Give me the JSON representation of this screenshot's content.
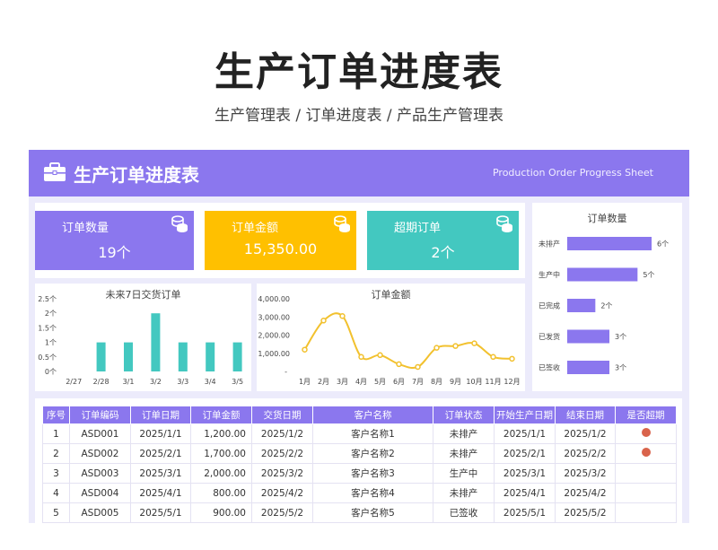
{
  "page": {
    "title": "生产订单进度表",
    "subtitle": "生产管理表 / 订单进度表 / 产品生产管理表"
  },
  "banner": {
    "title": "生产订单进度表",
    "subtitle_en": "Production Order Progress Sheet",
    "icon": "briefcase-icon",
    "color": "#8b77ee"
  },
  "cards": [
    {
      "label": "订单数量",
      "value": "19个",
      "color": "#8b77ee",
      "icon": "coins-icon"
    },
    {
      "label": "订单金额",
      "value": "15,350.00",
      "color": "#ffc000",
      "icon": "coins-icon"
    },
    {
      "label": "超期订单",
      "value": "2个",
      "color": "#43c8c0",
      "icon": "coins-icon"
    }
  ],
  "chart_data": [
    {
      "type": "bar",
      "title": "订单数量",
      "orientation": "horizontal",
      "categories": [
        "未排产",
        "生产中",
        "已完成",
        "已发货",
        "已签收"
      ],
      "values": [
        6,
        5,
        2,
        3,
        3
      ],
      "value_labels": [
        "6个",
        "5个",
        "2个",
        "3个",
        "3个"
      ],
      "xlim": [
        0,
        6
      ],
      "color": "#8b77ee"
    },
    {
      "type": "bar",
      "title": "未来7日交货订单",
      "categories": [
        "2/27",
        "2/28",
        "3/1",
        "3/2",
        "3/3",
        "3/4",
        "3/5"
      ],
      "values": [
        0,
        1,
        1,
        2,
        1,
        1,
        1
      ],
      "yticks": [
        "0个",
        "0.5个",
        "1个",
        "1.5个",
        "2个",
        "2.5个"
      ],
      "ylim": [
        0,
        2.5
      ],
      "color": "#43c8c0"
    },
    {
      "type": "line",
      "title": "订单金额",
      "categories": [
        "1月",
        "2月",
        "3月",
        "4月",
        "5月",
        "6月",
        "7月",
        "8月",
        "9月",
        "10月",
        "11月",
        "12月"
      ],
      "values": [
        1200,
        2800,
        3050,
        800,
        900,
        400,
        250,
        1300,
        1400,
        1550,
        800,
        700
      ],
      "yticks": [
        "-",
        "1,000.00",
        "2,000.00",
        "3,000.00",
        "4,000.00"
      ],
      "ylim": [
        0,
        4000
      ],
      "color": "#f2c12e"
    }
  ],
  "table": {
    "headers": [
      "序号",
      "订单编码",
      "订单日期",
      "订单金额",
      "交货日期",
      "客户名称",
      "订单状态",
      "开始生产日期",
      "结束日期",
      "是否超期"
    ],
    "rows": [
      [
        "1",
        "ASD001",
        "2025/1/1",
        "1,200.00",
        "2025/1/2",
        "客户名称1",
        "未排产",
        "2025/1/1",
        "2025/1/2",
        "overdue"
      ],
      [
        "2",
        "ASD002",
        "2025/2/1",
        "1,700.00",
        "2025/2/2",
        "客户名称2",
        "未排产",
        "2025/2/1",
        "2025/2/2",
        "overdue"
      ],
      [
        "3",
        "ASD003",
        "2025/3/1",
        "2,000.00",
        "2025/3/2",
        "客户名称3",
        "生产中",
        "2025/3/1",
        "2025/3/2",
        ""
      ],
      [
        "4",
        "ASD004",
        "2025/4/1",
        "800.00",
        "2025/4/2",
        "客户名称4",
        "未排产",
        "2025/4/1",
        "2025/4/2",
        ""
      ],
      [
        "5",
        "ASD005",
        "2025/5/1",
        "900.00",
        "2025/5/2",
        "客户名称5",
        "已签收",
        "2025/5/1",
        "2025/5/2",
        ""
      ]
    ],
    "overdue_color": "#d9634b"
  }
}
